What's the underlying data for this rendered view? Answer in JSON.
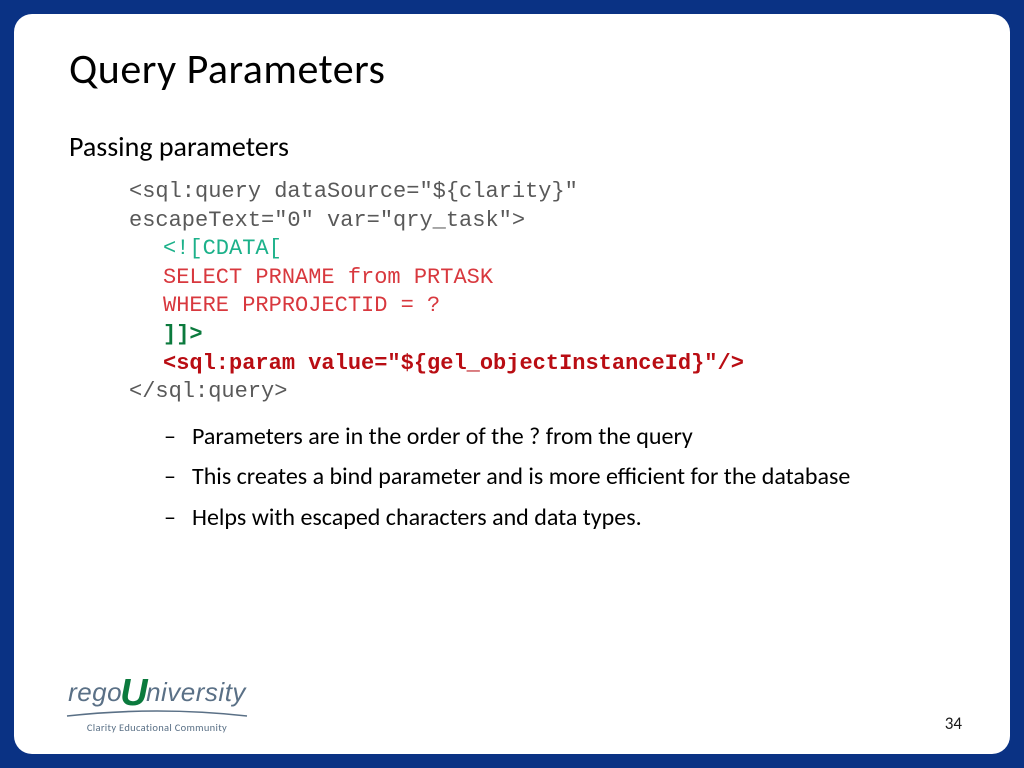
{
  "title": "Query Parameters",
  "subtitle": "Passing parameters",
  "code": {
    "open1": "<sql:query dataSource=\"${clarity}\"",
    "open2": "escapeText=\"0\" var=\"qry_task\">",
    "cdata_open": "<![CDATA[",
    "sql1": "SELECT PRNAME from PRTASK",
    "sql2": "WHERE PRPROJECTID = ?",
    "cdata_close": "]]>",
    "param": "<sql:param value=\"${gel_objectInstanceId}\"/>",
    "close": "</sql:query>"
  },
  "bullets": [
    "Parameters are in the order of the ? from the query",
    "This creates a bind parameter and is more efficient for the database",
    "Helps with escaped characters and data types."
  ],
  "logo": {
    "prefix": "rego",
    "u": "U",
    "suffix": "niversity",
    "tagline": "Clarity Educational Community"
  },
  "page_number": "34"
}
